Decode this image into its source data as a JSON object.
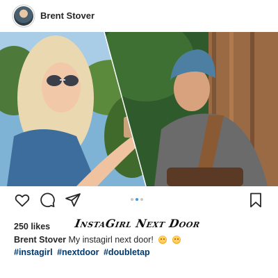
{
  "post": {
    "username": "Brent Stover",
    "overlay_title": "InstaGirl Next Door",
    "likes": "250 likes",
    "caption_user": "Brent Stover",
    "caption_text": "My instagirl next door!",
    "caption_emojis": [
      "smiling-face-with-heart-eyes",
      "smiling-face-with-heart-eyes"
    ],
    "hashtags": [
      "#instagirl",
      "#nextdoor",
      "#doubletap"
    ],
    "carousel": {
      "count": 3,
      "active_index": 1
    }
  },
  "icons": {
    "like": "heart-icon",
    "comment": "comment-bubble-icon",
    "share": "paper-plane-icon",
    "save": "bookmark-icon"
  },
  "colors": {
    "text": "#262626",
    "hashtag": "#00376b",
    "dot_active": "#3897f0",
    "dot_inactive": "#c7c7c7"
  }
}
